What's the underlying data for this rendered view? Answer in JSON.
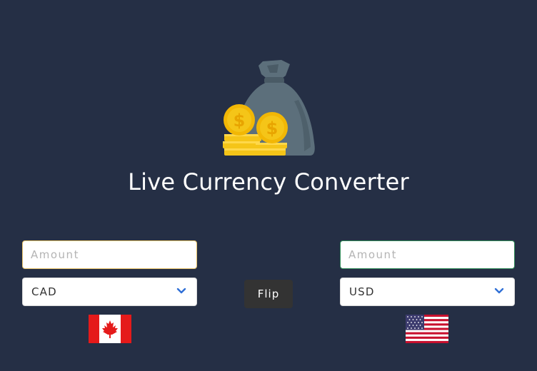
{
  "app": {
    "title": "Live Currency Converter"
  },
  "logo": {
    "icon": "money-bag-coins-icon",
    "bag_color": "#5c6f7b",
    "coin_color": "#f5c518"
  },
  "from": {
    "amount_placeholder": "Amount",
    "amount_value": "",
    "currency": "CAD",
    "flag": "canada-flag-icon"
  },
  "to": {
    "amount_placeholder": "Amount",
    "amount_value": "",
    "currency": "USD",
    "flag": "usa-flag-icon"
  },
  "flip_label": "Flip",
  "colors": {
    "background": "#252f45",
    "chevron": "#2f6fd6",
    "flip_button": "#333333"
  }
}
